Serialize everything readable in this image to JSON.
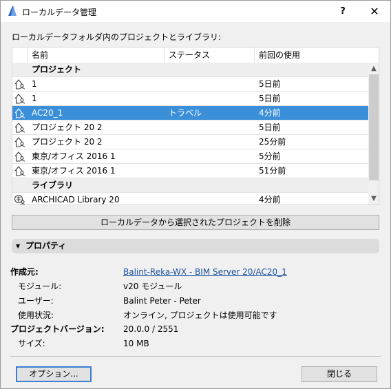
{
  "window": {
    "title": "ローカルデータ管理",
    "help_label": "?",
    "close_label": "✕"
  },
  "list_section": {
    "label": "ローカルデータフォルダ内のプロジェクトとライブラリ:",
    "columns": [
      "名前",
      "ステータス",
      "前回の使用"
    ]
  },
  "list": {
    "groups": {
      "projects": "プロジェクト",
      "libraries": "ライブラリ"
    },
    "rows": [
      {
        "icon": "project-icon",
        "name": "1",
        "status": "",
        "last_used": "5日前"
      },
      {
        "icon": "project-icon",
        "name": "1",
        "status": "",
        "last_used": "5日前"
      },
      {
        "icon": "project-icon",
        "name": "AC20_1",
        "status": "トラベル",
        "last_used": "4分前",
        "selected": true
      },
      {
        "icon": "project-icon",
        "name": "プロジェクト 20 2",
        "status": "",
        "last_used": "5日前"
      },
      {
        "icon": "project-icon",
        "name": "プロジェクト 20 2",
        "status": "",
        "last_used": "25分前"
      },
      {
        "icon": "project-icon",
        "name": "東京/オフィス 2016 1",
        "status": "",
        "last_used": "5分前"
      },
      {
        "icon": "project-icon",
        "name": "東京/オフィス 2016 1",
        "status": "",
        "last_used": "51分前"
      }
    ],
    "library_rows": [
      {
        "icon": "library-icon",
        "name": "ARCHICAD Library 20",
        "status": "",
        "last_used": "4分前"
      }
    ]
  },
  "actions": {
    "delete_label": "ローカルデータから選択されたプロジェクトを削除"
  },
  "properties": {
    "header": "プロパティ",
    "created_from_label": "作成元:",
    "created_from_value": "Balint-Reka-WX - BIM Server 20/AC20_1",
    "module_label": "モジュール:",
    "module_value": "v20 モジュール",
    "user_label": "ユーザー:",
    "user_value": "Balint Peter - Peter",
    "usage_label": "使用状況:",
    "usage_value": "オンライン, プロジェクトは使用可能です",
    "version_label": "プロジェクトバージョン:",
    "version_value": "20.0.0 / 2551",
    "size_label": "サイズ:",
    "size_value": "10 MB"
  },
  "footer": {
    "options_label": "オプション...",
    "close_label": "閉じる"
  },
  "colors": {
    "selection": "#3b8fd8",
    "link": "#1a4f9c",
    "focus": "#3b7fd0"
  }
}
